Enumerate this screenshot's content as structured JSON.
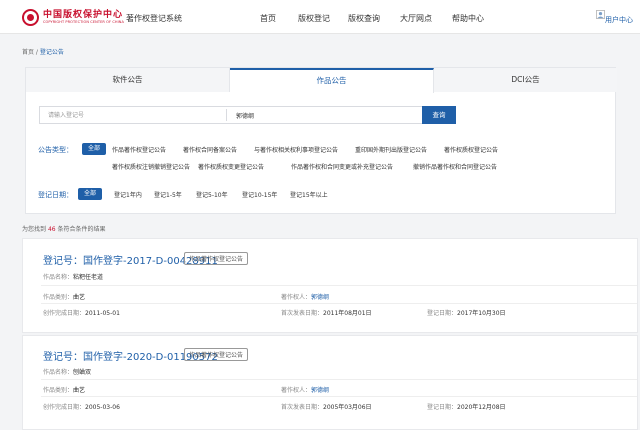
{
  "header": {
    "logo_cn": "中国版权保护中心",
    "logo_en": "COPYRIGHT PROTECTION CENTER OF CHINA",
    "system_title": "著作权登记系统",
    "nav": [
      "首页",
      "版权登记",
      "版权查询",
      "大厅网点",
      "帮助中心"
    ],
    "user_label": "用户中心"
  },
  "breadcrumb": {
    "home": "首页",
    "sep": " / ",
    "current": "登记公告"
  },
  "tabs": [
    "软件公告",
    "作品公告",
    "DCI公告"
  ],
  "active_tab": "作品公告",
  "search": {
    "reg_placeholder": "请输入登记号",
    "name_value": "郭德纲",
    "button": "查询"
  },
  "filters": {
    "type_label": "公告类型：",
    "type_all": "全部",
    "type_options_row1": [
      "作品著作权登记公告",
      "著作权合同备案公告",
      "与著作权相关权利事项登记公告",
      "重印国外期刊出版登记公告",
      "著作权质权登记公告"
    ],
    "type_options_row2": [
      "著作权质权注销撤销登记公告",
      "著作权质权变更登记公告",
      "作品著作权和合同变更或补充登记公告",
      "撤销作品著作权和合同登记公告"
    ],
    "date_label": "登记日期：",
    "date_all": "全部",
    "date_options": [
      "登记1年内",
      "登记1-5年",
      "登记5-10年",
      "登记10-15年",
      "登记15年以上"
    ]
  },
  "result": {
    "prefix": "为您找到",
    "count": "46",
    "suffix": "条符合条件的结果"
  },
  "records": [
    {
      "reg_label": "登记号：",
      "reg_no": "国作登字-2017-D-00428911",
      "tag": "作品著作权登记公告",
      "name_label": "作品名称：",
      "name": "粘粑任老道",
      "category_label": "作品类别：",
      "category": "曲艺",
      "owner_label": "著作权人：",
      "owner": "郭德纲",
      "completed_label": "创作完成日期：",
      "completed": "2011-05-01",
      "published_label": "首次发表日期：",
      "published": "2011年08月01日",
      "registered_label": "登记日期：",
      "registered": "2017年10月30日"
    },
    {
      "reg_label": "登记号：",
      "reg_no": "国作登字-2020-D-01190572",
      "tag": "作品著作权登记公告",
      "name_label": "作品名称：",
      "name": "刨蛐双",
      "category_label": "作品类别：",
      "category": "曲艺",
      "owner_label": "著作权人：",
      "owner": "郭德纲",
      "completed_label": "创作完成日期：",
      "completed": "2005-03-06",
      "published_label": "首次发表日期：",
      "published": "2005年03月06日",
      "registered_label": "登记日期：",
      "registered": "2020年12月08日"
    }
  ],
  "colors": {
    "accent": "#1f5fa8",
    "brand_red": "#c8102e"
  }
}
